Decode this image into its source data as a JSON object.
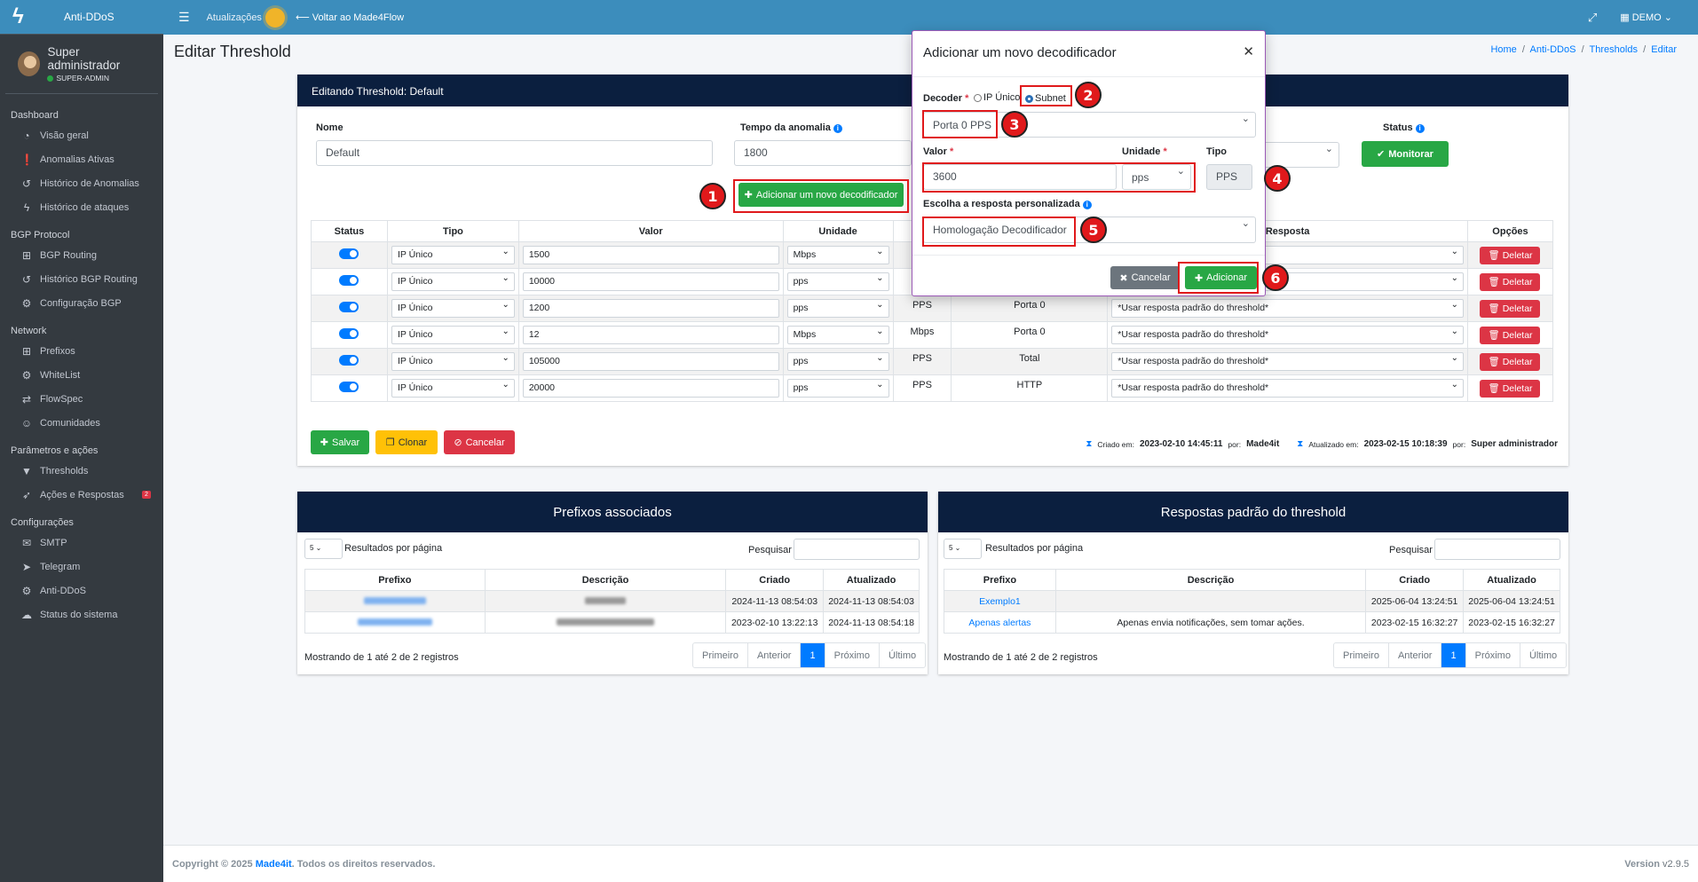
{
  "app": {
    "brand": "Anti-DDoS",
    "user_name": "Super administrador",
    "user_role": "SUPER-ADMIN"
  },
  "topbar": {
    "updates": "Atualizações",
    "back": "Voltar ao Made4Flow",
    "account": "DEMO"
  },
  "sidebar": {
    "sections": [
      {
        "header": "Dashboard",
        "items": [
          {
            "label": "Visão geral",
            "icon": "gauge-icon"
          },
          {
            "label": "Anomalias Ativas",
            "icon": "alert-icon"
          },
          {
            "label": "Histórico de Anomalias",
            "icon": "history-icon"
          },
          {
            "label": "Histórico de ataques",
            "icon": "bolt-icon"
          }
        ]
      },
      {
        "header": "BGP Protocol",
        "items": [
          {
            "label": "BGP Routing",
            "icon": "network-icon"
          },
          {
            "label": "Histórico BGP Routing",
            "icon": "history-icon"
          },
          {
            "label": "Configuração BGP",
            "icon": "gear-icon"
          }
        ]
      },
      {
        "header": "Network",
        "items": [
          {
            "label": "Prefixos",
            "icon": "network-icon"
          },
          {
            "label": "WhiteList",
            "icon": "gear-icon"
          },
          {
            "label": "FlowSpec",
            "icon": "flow-icon"
          },
          {
            "label": "Comunidades",
            "icon": "users-icon"
          }
        ]
      },
      {
        "header": "Parâmetros e ações",
        "items": [
          {
            "label": "Thresholds",
            "icon": "filter-icon"
          },
          {
            "label": "Ações e Respostas",
            "icon": "rocket-icon",
            "badge": "2"
          }
        ]
      },
      {
        "header": "Configurações",
        "items": [
          {
            "label": "SMTP",
            "icon": "mail-icon"
          },
          {
            "label": "Telegram",
            "icon": "telegram-icon"
          },
          {
            "label": "Anti-DDoS",
            "icon": "gears-icon"
          },
          {
            "label": "Status do sistema",
            "icon": "cloud-icon"
          }
        ]
      }
    ]
  },
  "page": {
    "title": "Editar Threshold",
    "breadcrumb": [
      "Home",
      "Anti-DDoS",
      "Thresholds",
      "Editar"
    ],
    "card_title": "Editando Threshold: Default",
    "form": {
      "name_label": "Nome",
      "name_value": "Default",
      "anomaly_label": "Tempo da anomalia",
      "anomaly_value": "1800",
      "status_label": "Status",
      "status_button": "Monitorar",
      "add_button": "Adicionar um novo decodificador"
    },
    "table": {
      "headers": [
        "Status",
        "Tipo",
        "Valor",
        "Unidade",
        "",
        "",
        "Resposta",
        "Opções"
      ],
      "rows": [
        {
          "tipo": "IP Único",
          "valor": "1500",
          "unidade": "Mbps",
          "kind": "",
          "decoder": "",
          "resposta": "",
          "delete": "Deletar"
        },
        {
          "tipo": "IP Único",
          "valor": "10000",
          "unidade": "pps",
          "kind": "",
          "decoder": "",
          "resposta": "",
          "delete": "Deletar"
        },
        {
          "tipo": "IP Único",
          "valor": "1200",
          "unidade": "pps",
          "kind": "PPS",
          "decoder": "Porta 0",
          "resposta": "*Usar resposta padrão do threshold*",
          "delete": "Deletar"
        },
        {
          "tipo": "IP Único",
          "valor": "12",
          "unidade": "Mbps",
          "kind": "Mbps",
          "decoder": "Porta 0",
          "resposta": "*Usar resposta padrão do threshold*",
          "delete": "Deletar"
        },
        {
          "tipo": "IP Único",
          "valor": "105000",
          "unidade": "pps",
          "kind": "PPS",
          "decoder": "Total",
          "resposta": "*Usar resposta padrão do threshold*",
          "delete": "Deletar"
        },
        {
          "tipo": "IP Único",
          "valor": "20000",
          "unidade": "pps",
          "kind": "PPS",
          "decoder": "HTTP",
          "resposta": "*Usar resposta padrão do threshold*",
          "delete": "Deletar"
        }
      ]
    },
    "actions": {
      "save": "Salvar",
      "clone": "Clonar",
      "cancel": "Cancelar"
    },
    "meta": {
      "created_label": "Criado em:",
      "created_at": "2023-02-10 14:45:11",
      "created_by_label": "por:",
      "created_by": "Made4it",
      "updated_label": "Atualizado em:",
      "updated_at": "2023-02-15 10:18:39",
      "updated_by_label": "por:",
      "updated_by": "Super administrador"
    }
  },
  "prefixes": {
    "title": "Prefixos associados",
    "per_page": "5",
    "per_page_label": "Resultados por página",
    "search_label": "Pesquisar",
    "headers": [
      "Prefixo",
      "Descrição",
      "Criado",
      "Atualizado"
    ],
    "rows": [
      {
        "criado": "2024-11-13 08:54:03",
        "atualizado": "2024-11-13 08:54:03"
      },
      {
        "criado": "2023-02-10 13:22:13",
        "atualizado": "2024-11-13 08:54:18"
      }
    ],
    "summary": "Mostrando de 1 até 2 de 2 registros",
    "pagination": [
      "Primeiro",
      "Anterior",
      "1",
      "Próximo",
      "Último"
    ]
  },
  "responses": {
    "title": "Respostas padrão do threshold",
    "per_page": "5",
    "per_page_label": "Resultados por página",
    "search_label": "Pesquisar",
    "headers": [
      "Prefixo",
      "Descrição",
      "Criado",
      "Atualizado"
    ],
    "rows": [
      {
        "prefixo": "Exemplo1",
        "descricao": "",
        "criado": "2025-06-04 13:24:51",
        "atualizado": "2025-06-04 13:24:51"
      },
      {
        "prefixo": "Apenas alertas",
        "descricao": "Apenas envia notificações, sem tomar ações.",
        "criado": "2023-02-15 16:32:27",
        "atualizado": "2023-02-15 16:32:27"
      }
    ],
    "summary": "Mostrando de 1 até 2 de 2 registros",
    "pagination": [
      "Primeiro",
      "Anterior",
      "1",
      "Próximo",
      "Último"
    ]
  },
  "modal": {
    "title": "Adicionar um novo decodificador",
    "decoder_label": "Decoder",
    "option_ip": "IP Único",
    "option_subnet": "Subnet",
    "decoder_value": "Porta 0 PPS",
    "valor_label": "Valor",
    "valor_value": "3600",
    "unidade_label": "Unidade",
    "unidade_value": "pps",
    "tipo_label": "Tipo",
    "tipo_value": "PPS",
    "resposta_label": "Escolha a resposta personalizada",
    "resposta_value": "Homologação Decodificador",
    "cancel": "Cancelar",
    "add": "Adicionar"
  },
  "callouts": [
    "1",
    "2",
    "3",
    "4",
    "5",
    "6"
  ],
  "footer": {
    "copyright": "Copyright © 2025",
    "company": "Made4it",
    "rights": ". Todos os direitos reservados.",
    "version_label": "Version",
    "version": "v2.9.5"
  },
  "colors": {
    "primary": "#3c8dbc",
    "header_dark": "#0b1f3f",
    "sidebar": "#343a40",
    "success": "#28a745",
    "danger": "#dc3545",
    "warning": "#ffc107",
    "callout": "#e0191b"
  }
}
